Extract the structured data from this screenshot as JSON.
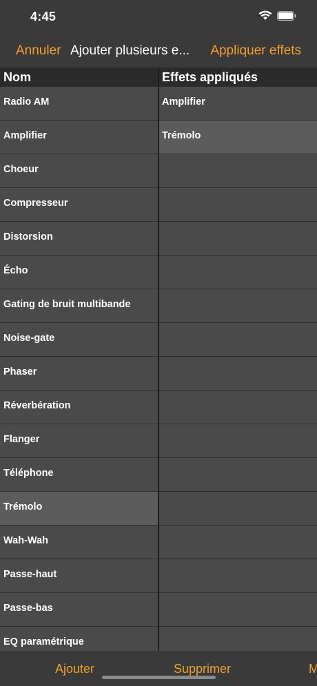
{
  "status": {
    "time": "4:45"
  },
  "nav": {
    "cancel_label": "Annuler",
    "title": "Ajouter plusieurs e...",
    "apply_label": "Appliquer effets"
  },
  "left_column": {
    "header": "Nom",
    "rows": [
      "Radio AM",
      "Amplifier",
      "Choeur",
      "Compresseur",
      "Distorsion",
      "Écho",
      "Gating de bruit multibande",
      "Noise-gate",
      "Phaser",
      "Réverbération",
      "Flanger",
      "Téléphone",
      "Trémolo",
      "Wah-Wah",
      "Passe-haut",
      "Passe-bas",
      "EQ paramétrique"
    ]
  },
  "right_column": {
    "header": "Effets appliqués",
    "rows": [
      "Amplifier",
      "Trémolo",
      "",
      "",
      "",
      "",
      "",
      "",
      "",
      "",
      "",
      "",
      "",
      "",
      "",
      "",
      ""
    ]
  },
  "toolbar": {
    "add_label": "Ajouter",
    "delete_label": "Supprimer",
    "more_label": "M"
  },
  "colors": {
    "accent": "#f0a030"
  }
}
